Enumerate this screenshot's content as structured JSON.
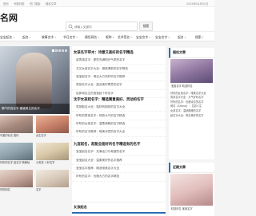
{
  "topbar": {
    "links": [
      "首页",
      "专题列表",
      "热门搜索",
      "随机文章"
    ],
    "date": "2025年04月01日"
  },
  "header": {
    "logo": "名网",
    "search": {
      "placeholder": "请输入关键词",
      "button": "搜索"
    }
  },
  "nav": {
    "items": [
      "宝宝起名",
      "起名",
      "故事名字",
      "节日名字",
      "情侣网名",
      "昵称",
      "艺术签名",
      "宝宝名字",
      "宝宝名字",
      "起名",
      "搜索"
    ]
  },
  "banner": {
    "caption": "霸气的连名字·霸道男生的名字"
  },
  "tiles": [
    {
      "caption": "可爱的仙名 爱情"
    },
    {
      "caption": "女生名字"
    },
    {
      "caption": "好听的名字 最名字 萌萌哒"
    },
    {
      "caption": "小男孩 人好名字"
    },
    {
      "caption": "好的网名"
    },
    {
      "caption": "名字"
    }
  ],
  "sections": [
    {
      "title": "女孩名字带木：诗意又美好的名字精选",
      "items": [
        "起男孩名字：那些充满阳光气质的名字",
        "文艺女孩名字大全：雅致清新的名字精选",
        "宝宝起名字：简洁大方的好听名字推荐",
        "男孩名字大全：蕴含美好寓意的名字",
        "给即将出生的宝宝起个好名字"
      ]
    },
    {
      "title": "沈字女孩起名字：精选寓意美好、灵动的名字",
      "items": [
        "男孩取名大全：独特有韵味的名字大全",
        "好听的男孩名字：响亮大气的名字精选",
        "好听的女孩名字：温柔典雅的名字精选",
        "好听的名字推荐：唯美诗意的名字大全"
      ]
    },
    {
      "title": "九宫起名，起能全面好听名字精选有的名字",
      "items": [
        "宝宝起名名字：充满活力与希望的名字",
        "宝宝起名大全：温柔美好的名字推荐",
        "宝宝名字推荐：精选唯美名字大全",
        "好听的名字：优雅大方的名字精选"
      ]
    }
  ],
  "section_title_bottom": "女孩起名",
  "right": {
    "panel1_title": "随机文章",
    "panel1_caption": "宝宝名字·精选好名",
    "panel1_items": [
      "好听的女孩名字：唯美名字大全",
      "男孩名字大全：大气好听名字",
      "好听的名字：优雅诗意的名字",
      "网名（Aillsng）：名如人生",
      "女孩名字：温婉典雅的名字",
      "起名字大全：寓意美好的名字"
    ],
    "panel2_title": "近期文章",
    "panel2_caption": "精选好名·宝宝名字"
  }
}
